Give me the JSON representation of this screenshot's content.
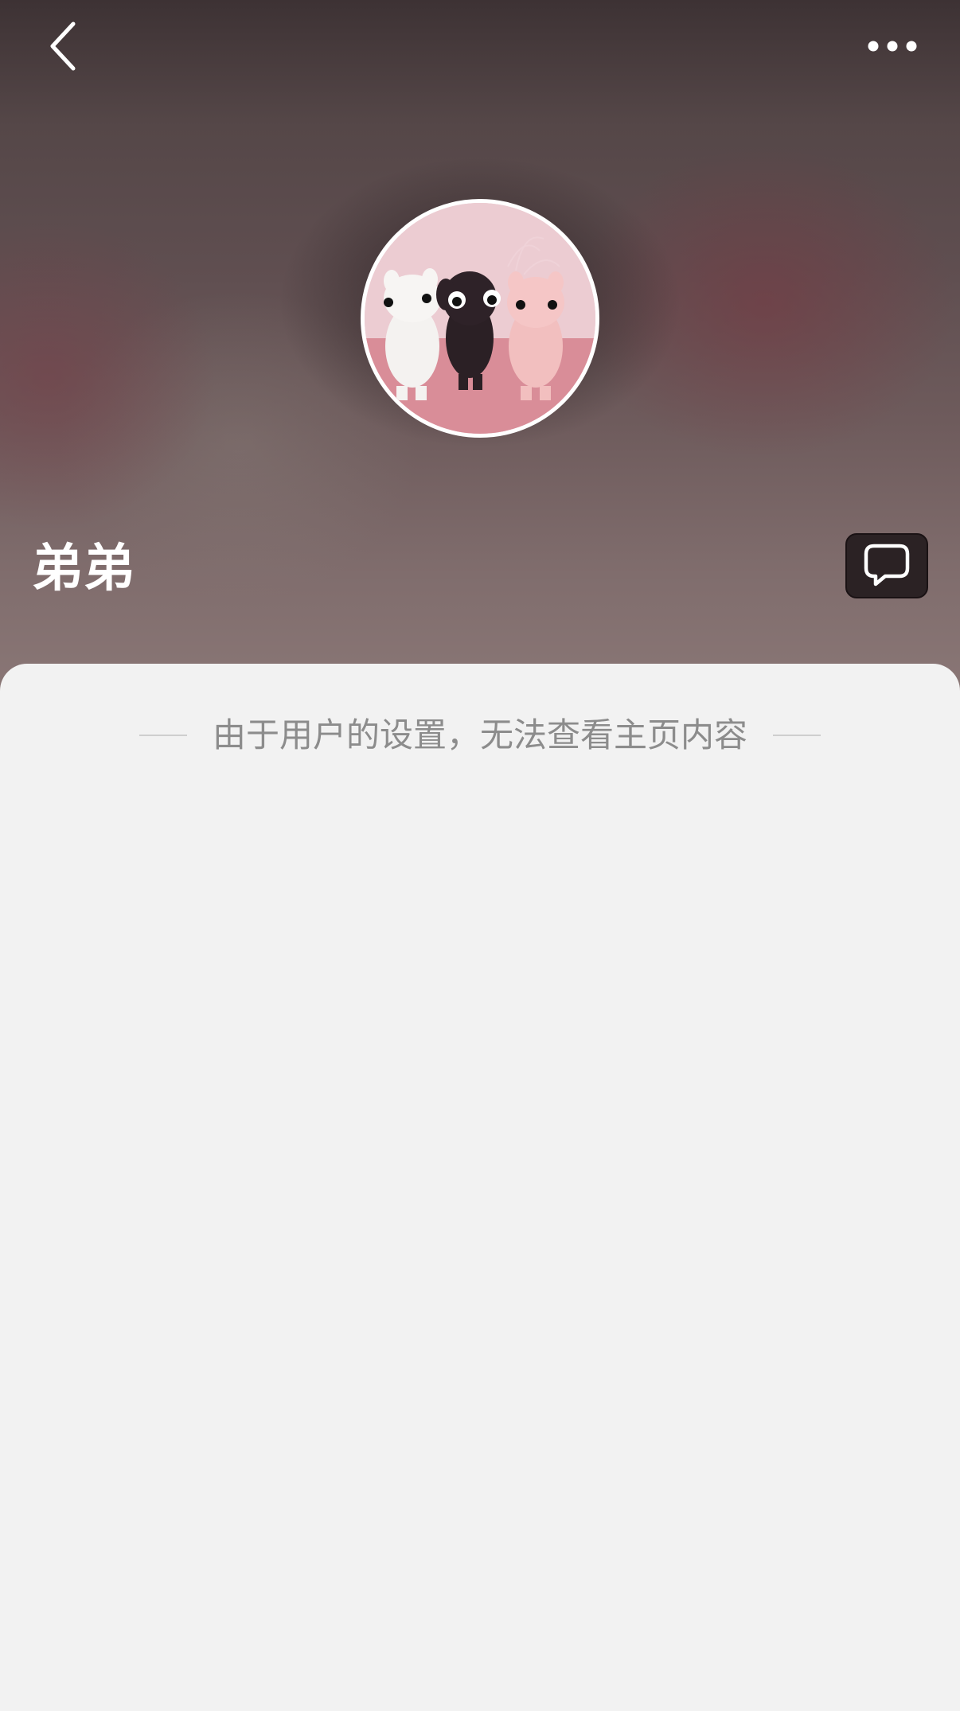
{
  "header": {
    "back_icon": "chevron-left-icon",
    "more_icon": "more-horizontal-icon",
    "avatar_description_icon": "avatar-plush-toys",
    "username": "弟弟",
    "chat_icon": "chat-bubble-icon"
  },
  "main": {
    "notice": "由于用户的设置，无法查看主页内容"
  },
  "colors": {
    "background": "#f2f2f2",
    "notice_text": "#8c8c8c",
    "header_top": "#3d3234",
    "header_bottom": "#8a7776",
    "chat_button": "#2b2224"
  }
}
